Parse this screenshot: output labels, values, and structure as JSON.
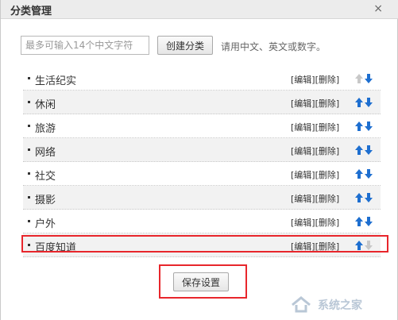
{
  "dialog": {
    "title": "分类管理",
    "close_glyph": "×"
  },
  "add": {
    "placeholder": "最多可输入14个中文字符",
    "create_label": "创建分类",
    "hint": "请用中文、英文或数字。"
  },
  "categories": [
    {
      "name": "生活纪实",
      "edit": "[编辑]",
      "delete": "[删除]",
      "up_enabled": false,
      "down_enabled": true
    },
    {
      "name": "休闲",
      "edit": "[编辑]",
      "delete": "[删除]",
      "up_enabled": true,
      "down_enabled": true
    },
    {
      "name": "旅游",
      "edit": "[编辑]",
      "delete": "[删除]",
      "up_enabled": true,
      "down_enabled": true
    },
    {
      "name": "网络",
      "edit": "[编辑]",
      "delete": "[删除]",
      "up_enabled": true,
      "down_enabled": true
    },
    {
      "name": "社交",
      "edit": "[编辑]",
      "delete": "[删除]",
      "up_enabled": true,
      "down_enabled": true
    },
    {
      "name": "摄影",
      "edit": "[编辑]",
      "delete": "[删除]",
      "up_enabled": true,
      "down_enabled": true
    },
    {
      "name": "户外",
      "edit": "[编辑]",
      "delete": "[删除]",
      "up_enabled": true,
      "down_enabled": true
    },
    {
      "name": "百度知道",
      "edit": "[编辑]",
      "delete": "[删除]",
      "up_enabled": true,
      "down_enabled": false
    }
  ],
  "save_label": "保存设置",
  "watermark": {
    "text": "系统之家"
  },
  "colors": {
    "arrow_active": "#1e6fd0",
    "arrow_disabled": "#c8c8c8",
    "highlight": "#e8262c"
  },
  "icons": {
    "up": "arrow-up-icon",
    "down": "arrow-down-icon",
    "close": "close-icon"
  }
}
